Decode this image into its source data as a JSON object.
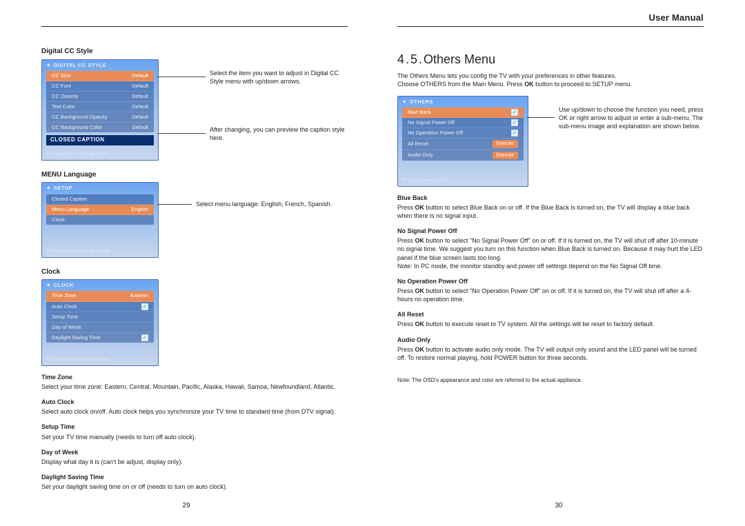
{
  "header": {
    "manual_title": "User Manual"
  },
  "page_left": {
    "digital_cc": {
      "label": "Digital CC Style",
      "osd_title": "DIGITAL CC STYLE",
      "rows": [
        {
          "k": "CC Size",
          "v": "Default",
          "hl": true
        },
        {
          "k": "CC Font",
          "v": "Default"
        },
        {
          "k": "CC Opacity",
          "v": "Default"
        },
        {
          "k": "Text Color",
          "v": "Default"
        },
        {
          "k": "CC Background Opacity",
          "v": "Default"
        },
        {
          "k": "CC Background Color",
          "v": "Default"
        }
      ],
      "caption_bar": "CLOSED CAPTION",
      "foot": "Return    Move    Change Setting",
      "note1": "Select the item you want to adjust in Digital CC Style menu with up/down arrows.",
      "note2": "After changing, you can preview the caption style here."
    },
    "menu_lang": {
      "label": "MENU Language",
      "osd_title": "SETUP",
      "rows": [
        {
          "k": "Closed Caption",
          "v": ""
        },
        {
          "k": "Menu Language",
          "v": "English",
          "hl": true
        },
        {
          "k": "Clock",
          "v": ""
        }
      ],
      "foot": "Return    Move    Change Setting",
      "note": "Select menu language: English, French, Spanish."
    },
    "clock": {
      "label": "Clock",
      "osd_title": "CLOCK",
      "rows": [
        {
          "k": "Time Zone",
          "v": "Eastern",
          "hl": true
        },
        {
          "k": "Auto Clock",
          "v": "✓"
        },
        {
          "k": "Setup Time",
          "v": ""
        },
        {
          "k": "Day of Week",
          "v": ""
        },
        {
          "k": "Daylight Saving Time",
          "v": "✓"
        }
      ],
      "foot": "Return    Move    Change Setting"
    },
    "items": [
      {
        "t": "Time Zone",
        "d": "Select your time zone: Eastern, Central, Mountain, Pacific, Alaska, Hawaii, Samoa, Newfoundland, Atlantic."
      },
      {
        "t": "Auto Clock",
        "d": "Select auto clock on/off. Auto clock helps you synchronize your TV time to standard time (from DTV signal)."
      },
      {
        "t": "Setup Time",
        "d": "Set your TV time manually (needs to turn off auto clock)."
      },
      {
        "t": "Day of Week",
        "d": "Display what day it is (can't be adjust, display only)."
      },
      {
        "t": "Daylight Saving Time",
        "d": "Set your daylight saving time on or off (needs to turn on auto clock)."
      }
    ],
    "page_no": "29"
  },
  "page_right": {
    "chapter_num": "4.5.",
    "chapter_title": "Others Menu",
    "intro1": "The Others Menu lets you config the TV with your preferences in other features.",
    "intro2_a": "Choose OTHERS from the Main Menu. Press ",
    "intro2_key": "OK",
    "intro2_b": " button to proceed to SETUP menu.",
    "osd": {
      "title": "OTHERS",
      "rows": [
        {
          "k": "Blue Back",
          "v": "✓",
          "hl": true
        },
        {
          "k": "No Signal Power Off",
          "v": "✓"
        },
        {
          "k": "No Operation Power Off",
          "v": "✓"
        },
        {
          "k": "All Reset",
          "v": "Execute",
          "btn": true
        },
        {
          "k": "Audio Only",
          "v": "Execute",
          "btn": true
        }
      ],
      "foot": "Return    Move    On/Off",
      "note": "Use up/down to choose the function you need, press OK or right arrow to adjust or enter a sub-menu. The sub-menu image and explanation are shown below."
    },
    "sections": [
      {
        "t": "Blue Back",
        "d": "Press OK button to select Blue Back on or off. If the Blue Back is turned on, the TV will display a blue back when there is no signal input."
      },
      {
        "t": "No Signal Power Off",
        "d": "Press OK button to select \"No Signal Power Off\" on or off. If it is turned on, the TV will shut off after 10-minute no signal time. We suggest you turn on this function when Blue Back is turned on. Because it may hurt the LED panel if the blue screen lasts too long.\nNote: In PC mode, the monitor standby and power off settings depend on the No Signal Off time."
      },
      {
        "t": "No Operation Power Off",
        "d": "Press OK button to select \"No Operation Power Off\" on or off. If it is turned on, the TV will shut off after a 4-hours no operation time."
      },
      {
        "t": "All Reset",
        "d": "Press OK button to execute reset to TV system. All the settings will be reset to factory default."
      },
      {
        "t": "Audio Only",
        "d": "Press OK button to activate audio only mode. The TV will output only sound and the LED panel will be turned off. To restore normal playing, hold POWER button for three seconds."
      }
    ],
    "footnote": "Note: The OSD's appearance and color are referred to the actual appliance.",
    "page_no": "30"
  }
}
